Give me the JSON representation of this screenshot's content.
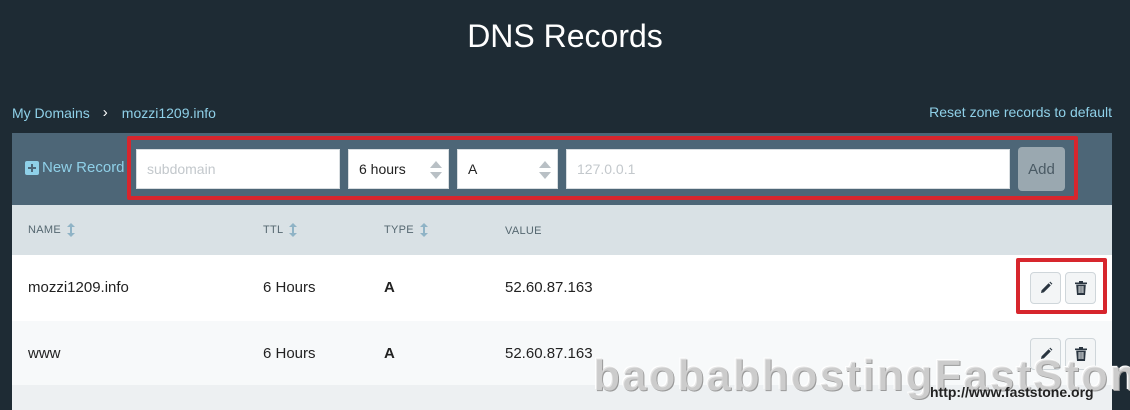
{
  "header": {
    "title": "DNS Records"
  },
  "breadcrumb": {
    "items": [
      "My Domains",
      "mozzi1209.info"
    ],
    "separator": "›"
  },
  "reset_link": "Reset zone records to default",
  "toolbar": {
    "new_record_label": "New Record",
    "subdomain_placeholder": "subdomain",
    "ttl_value": "6 hours",
    "type_value": "A",
    "value_placeholder": "127.0.0.1",
    "add_label": "Add"
  },
  "table": {
    "columns": [
      "NAME",
      "TTL",
      "TYPE",
      "VALUE"
    ],
    "rows": [
      {
        "name": "mozzi1209.info",
        "ttl": "6 Hours",
        "type": "A",
        "value": "52.60.87.163"
      },
      {
        "name": "www",
        "ttl": "6 Hours",
        "type": "A",
        "value": "52.60.87.163"
      }
    ]
  },
  "watermark": {
    "text": "baobabhostingFastStone",
    "url": "http://www.faststone.org"
  },
  "colors": {
    "header_bg": "#1e2b34",
    "toolbar_bg": "#4d6677",
    "link": "#8fd0e8",
    "highlight": "#d7262d"
  }
}
